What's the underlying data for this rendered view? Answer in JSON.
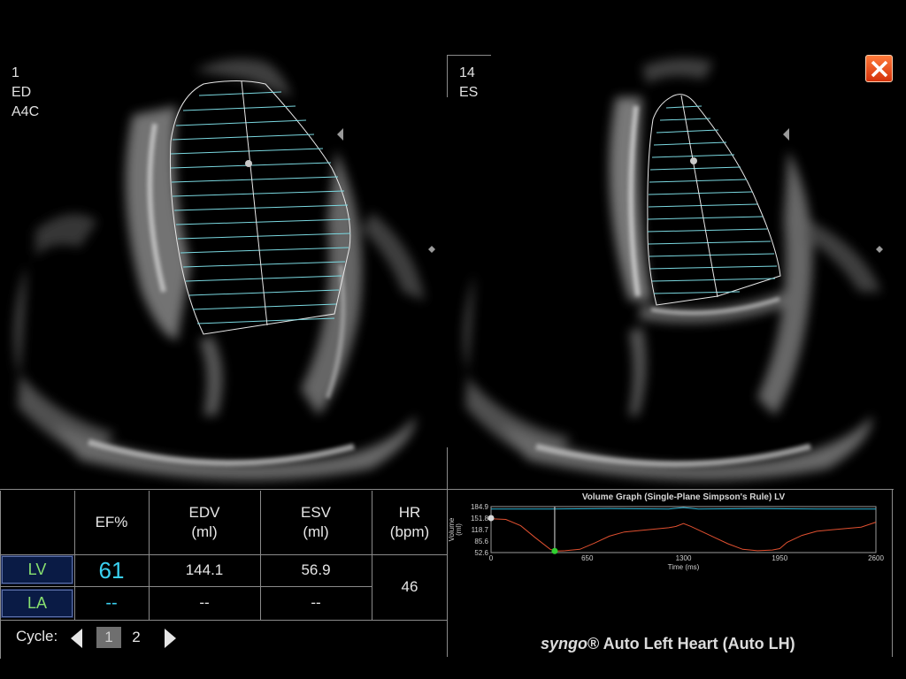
{
  "left_view": {
    "frame": "1",
    "phase": "ED",
    "view": "A4C"
  },
  "right_view": {
    "frame": "14",
    "phase": "ES"
  },
  "close_icon": "close-x-icon",
  "table": {
    "headers": {
      "ef": "EF%",
      "edv": "EDV\n(ml)",
      "esv": "ESV\n(ml)",
      "hr": "HR\n(bpm)"
    },
    "rows": [
      {
        "label": "LV",
        "ef": "61",
        "edv": "144.1",
        "esv": "56.9"
      },
      {
        "label": "LA",
        "ef": "--",
        "edv": "--",
        "esv": "--"
      }
    ],
    "hr": "46",
    "ef_color": "#3ad0f0",
    "label_color": "#88e070"
  },
  "cycle": {
    "label": "Cycle:",
    "options": [
      "1",
      "2"
    ],
    "selected": "1"
  },
  "branding": {
    "syngo": "syngo",
    "rest": "® Auto Left Heart (Auto LH)"
  },
  "chart_data": {
    "type": "line",
    "title": "Volume Graph (Single-Plane Simpson's Rule) LV",
    "xlabel": "Time (ms)",
    "ylabel": "Volume (ml)",
    "xlim": [
      0,
      2600
    ],
    "ylim": [
      52.6,
      184.9
    ],
    "xticks": [
      "0",
      "650",
      "1300",
      "1950",
      "2600"
    ],
    "yticks": [
      "184.9",
      "151.8",
      "118.7",
      "85.6",
      "52.6"
    ],
    "series": [
      {
        "color": "#e05030",
        "x": [
          0,
          100,
          200,
          300,
          400,
          450,
          500,
          600,
          700,
          800,
          900,
          1000,
          1100,
          1200,
          1250,
          1300,
          1350,
          1400,
          1500,
          1600,
          1700,
          1800,
          1900,
          1950,
          2000,
          2100,
          2200,
          2300,
          2400,
          2500,
          2600
        ],
        "y": [
          150,
          148,
          130,
          95,
          62,
          57,
          58,
          62,
          80,
          100,
          112,
          116,
          120,
          124,
          128,
          136,
          128,
          118,
          98,
          78,
          62,
          58,
          60,
          64,
          82,
          102,
          114,
          118,
          122,
          126,
          140
        ]
      },
      {
        "color": "#30b8d8",
        "x": [
          0,
          400,
          800,
          1200,
          1300,
          1400,
          1800,
          2200,
          2600
        ],
        "y": [
          178,
          178,
          179,
          178,
          182,
          178,
          179,
          178,
          178
        ]
      }
    ],
    "marker": {
      "x": 430,
      "y": 57
    },
    "cursor_x": 430
  }
}
